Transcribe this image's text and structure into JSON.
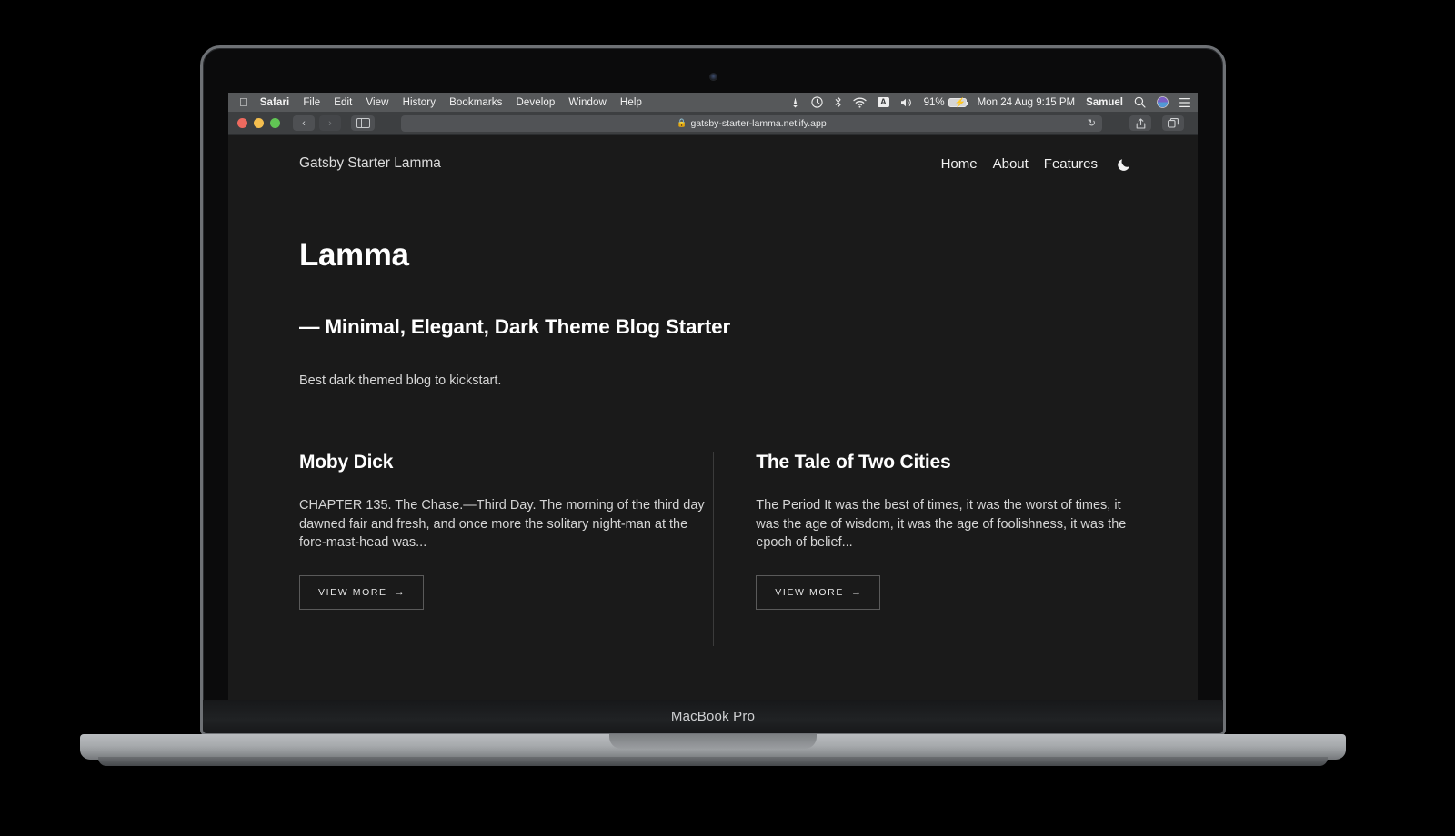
{
  "device": {
    "model_label": "MacBook Pro"
  },
  "menubar": {
    "apple_glyph": "",
    "items": [
      {
        "label": "Safari",
        "bold": true
      },
      {
        "label": "File",
        "bold": false
      },
      {
        "label": "Edit",
        "bold": false
      },
      {
        "label": "View",
        "bold": false
      },
      {
        "label": "History",
        "bold": false
      },
      {
        "label": "Bookmarks",
        "bold": false
      },
      {
        "label": "Develop",
        "bold": false
      },
      {
        "label": "Window",
        "bold": false
      },
      {
        "label": "Help",
        "bold": false
      }
    ],
    "status": {
      "screen_share_icon": "screen-sharing-icon",
      "time_machine_icon": "time-machine-icon",
      "bluetooth_icon": "bluetooth-icon",
      "wifi_icon": "wifi-icon",
      "input_source": "A",
      "volume_icon": "volume-icon",
      "battery_percent": "91%",
      "battery_charging": true,
      "datetime": "Mon 24 Aug  9:15 PM",
      "user": "Samuel",
      "search_icon": "spotlight-search-icon",
      "siri_icon": "siri-icon",
      "control_center_icon": "control-center-icon"
    }
  },
  "browser": {
    "traffic_lights": [
      "close",
      "minimize",
      "zoom"
    ],
    "back_label": "‹",
    "forward_label": "›",
    "sidebar_icon": "sidebar-icon",
    "url": "gatsby-starter-lamma.netlify.app",
    "lock_icon": "lock-icon",
    "reload_icon": "↻",
    "share_icon": "share-icon",
    "tabs_icon": "tab-overview-icon",
    "new_tab_icon": "+"
  },
  "site": {
    "title": "Gatsby Starter Lamma",
    "nav": [
      {
        "label": "Home"
      },
      {
        "label": "About"
      },
      {
        "label": "Features"
      }
    ],
    "theme_toggle_icon": "moon-icon"
  },
  "hero": {
    "heading": "Lamma",
    "subheading": "— Minimal, Elegant, Dark Theme Blog Starter",
    "description": "Best dark themed blog to kickstart."
  },
  "posts": [
    {
      "title": "Moby Dick",
      "excerpt": "CHAPTER 135. The Chase.—Third Day. The morning of the third day dawned fair and fresh, and once more the solitary night-man at the fore-mast-head was...",
      "cta": "VIEW MORE",
      "cta_arrow": "→"
    },
    {
      "title": "The Tale of Two Cities",
      "excerpt": "The Period It was the best of times, it was the worst of times, it was the age of wisdom, it was the age of foolishness, it was the epoch of belief...",
      "cta": "VIEW MORE",
      "cta_arrow": "→"
    }
  ],
  "colors": {
    "page_bg": "#1a1a1a",
    "text": "#e9e9e9",
    "divider": "#3b3b3b",
    "menubar_bg": "#56585a",
    "toolbar_bg": "#3d3f41"
  }
}
